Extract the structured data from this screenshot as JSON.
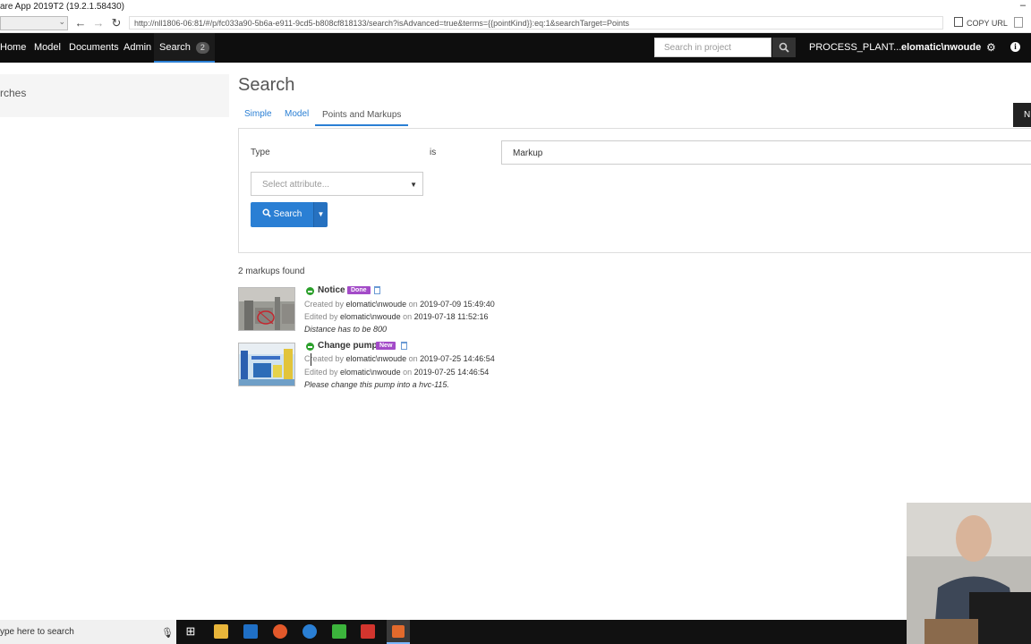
{
  "window": {
    "title": "are App 2019T2 (19.2.1.58430)",
    "minimize": "–"
  },
  "address": {
    "url": "http://nll1806-06:81/#/p/fc033a90-5b6a-e911-9cd5-b808cf818133/search?isAdvanced=true&terms={{pointKind}}:eq:1&searchTarget=Points",
    "copy_url": "COPY URL",
    "back_icon": "arrow-left-icon",
    "forward_icon": "arrow-right-icon",
    "reload_icon": "reload-icon"
  },
  "nav": {
    "home": "Home",
    "model": "Model",
    "documents": "Documents",
    "admin": "Admin",
    "search": "Search",
    "search_badge": "2",
    "search_placeholder": "Search in project",
    "project": "PROCESS_PLANT...",
    "user": "elomatic\\nwoude",
    "colors": {
      "bar": "#0e0e0e",
      "accent": "#2a7fd4"
    }
  },
  "sidebar": {
    "label": "rches"
  },
  "page": {
    "title": "Search",
    "tabs": [
      "Simple",
      "Model",
      "Points and Markups"
    ],
    "active_tab": "Points and Markups",
    "new_button": "N"
  },
  "filter": {
    "type_label": "Type",
    "is_label": "is",
    "type_value": "Markup",
    "attribute_placeholder": "Select attribute...",
    "search_button": "Search"
  },
  "results": {
    "count_text": "2 markups found",
    "items": [
      {
        "title": "Notice",
        "status": "Done",
        "created_prefix": "Created by",
        "created_by": "elomatic\\nwoude",
        "on1": "on",
        "created_at": "2019-07-09 15:49:40",
        "edited_prefix": "Edited by",
        "edited_by": "elomatic\\nwoude",
        "on2": "on",
        "edited_at": "2019-07-18 11:52:16",
        "description": "Distance has to be 800"
      },
      {
        "title": "Change pump",
        "status": "New",
        "created_prefix": "Created by",
        "created_by": "elomatic\\nwoude",
        "on1": "on",
        "created_at": "2019-07-25 14:46:54",
        "edited_prefix": "Edited by",
        "edited_by": "elomatic\\nwoude",
        "on2": "on",
        "edited_at": "2019-07-25 14:46:54",
        "description": "Please change this pump into a hvc-115."
      }
    ]
  },
  "taskbar": {
    "search_placeholder": "ype here to search"
  }
}
